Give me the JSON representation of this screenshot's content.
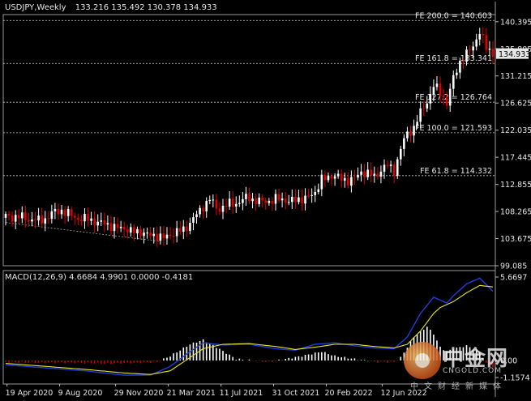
{
  "header": {
    "symbol": "USDJPY,Weekly",
    "ohlc": "133.216 135.492 130.378 134.933"
  },
  "current_price_label": "134.933",
  "macd_header": "MACD(12,26,9) 4.6684 4.9901 0.0000 -0.4181",
  "watermark": {
    "cn": "中金网",
    "en": "CNGOLD.COM",
    "sub": "中文财经新媒体"
  },
  "colors": {
    "background": "#000000",
    "bull": "#ffffff",
    "bear": "#e00000",
    "grid_dash": "#c8c8c8",
    "macd_line": "#1f3fd8",
    "signal_line": "#e8e82a"
  },
  "chart_data": [
    {
      "type": "candlestick",
      "price_axis": {
        "min": 99.085,
        "max": 141.6,
        "ticks": [
          "140.395",
          "135.805",
          "131.215",
          "126.625",
          "122.035",
          "117.445",
          "112.855",
          "108.265",
          "103.675",
          "99.085"
        ]
      },
      "time_axis_labels": [
        "19 Apr 2020",
        "9 Aug 2020",
        "29 Nov 2020",
        "21 Mar 2021",
        "11 Jul 2021",
        "31 Oct 2021",
        "20 Feb 2022",
        "12 Jun 2022"
      ],
      "fibonacci_levels": [
        {
          "label": "FE 200.0 = 140.603",
          "value": 140.603
        },
        {
          "label": "FE 161.8 = 133.341",
          "value": 133.341
        },
        {
          "label": "FE 127.2 = 126.764",
          "value": 126.764
        },
        {
          "label": "FE 100.0 = 121.593",
          "value": 121.593
        },
        {
          "label": "FE 61.8 = 114.332",
          "value": 114.332
        }
      ],
      "close_path": [
        [
          0,
          107.5
        ],
        [
          6,
          107.2
        ],
        [
          10,
          106.6
        ],
        [
          14,
          107.8
        ],
        [
          17,
          108.6
        ],
        [
          20,
          107.4
        ],
        [
          24,
          107.0
        ],
        [
          28,
          106.5
        ],
        [
          32,
          105.8
        ],
        [
          36,
          105.3
        ],
        [
          40,
          104.8
        ],
        [
          44,
          104.3
        ],
        [
          48,
          103.8
        ],
        [
          50,
          104.4
        ],
        [
          54,
          105.2
        ],
        [
          58,
          107.6
        ],
        [
          60,
          109.3
        ],
        [
          62,
          110.3
        ],
        [
          64,
          108.8
        ],
        [
          68,
          109.4
        ],
        [
          72,
          110.2
        ],
        [
          74,
          110.6
        ],
        [
          78,
          109.8
        ],
        [
          82,
          110.4
        ],
        [
          86,
          110.1
        ],
        [
          90,
          110.3
        ],
        [
          94,
          111.4
        ],
        [
          96,
          113.8
        ],
        [
          100,
          114.3
        ],
        [
          104,
          113.4
        ],
        [
          106,
          113.8
        ],
        [
          108,
          115.1
        ],
        [
          110,
          114.6
        ],
        [
          112,
          114.2
        ],
        [
          114,
          115.4
        ],
        [
          116,
          115.9
        ],
        [
          118,
          115.3
        ],
        [
          120,
          118.8
        ],
        [
          122,
          121.5
        ],
        [
          124,
          122.6
        ],
        [
          126,
          124.8
        ],
        [
          128,
          127.0
        ],
        [
          130,
          129.5
        ],
        [
          132,
          128.4
        ],
        [
          134,
          126.7
        ],
        [
          136,
          130.8
        ],
        [
          138,
          133.6
        ],
        [
          140,
          135.0
        ],
        [
          142,
          136.2
        ],
        [
          144,
          138.7
        ],
        [
          146,
          136.1
        ],
        [
          148,
          134.933
        ]
      ],
      "trendline": {
        "from": [
          0,
          106.4
        ],
        "to": [
          47,
          103.2
        ]
      }
    },
    {
      "type": "macd",
      "params": "12,26,9",
      "values": {
        "macd": 4.6684,
        "signal": 4.9901,
        "osma_zero": 0.0,
        "hist": -0.4181
      },
      "axis_labels": [
        "5.6697",
        "0.00",
        "-1.1574"
      ],
      "range": [
        -1.1574,
        5.6697
      ],
      "macd_path": [
        [
          0,
          -0.3
        ],
        [
          12,
          -0.5
        ],
        [
          24,
          -0.7
        ],
        [
          36,
          -1.0
        ],
        [
          44,
          -1.0
        ],
        [
          50,
          -0.4
        ],
        [
          56,
          0.6
        ],
        [
          60,
          1.2
        ],
        [
          66,
          1.05
        ],
        [
          74,
          1.1
        ],
        [
          82,
          0.8
        ],
        [
          88,
          0.7
        ],
        [
          94,
          1.1
        ],
        [
          100,
          1.2
        ],
        [
          106,
          1.0
        ],
        [
          112,
          0.85
        ],
        [
          118,
          0.8
        ],
        [
          122,
          1.6
        ],
        [
          126,
          3.2
        ],
        [
          130,
          4.3
        ],
        [
          132,
          4.1
        ],
        [
          134,
          3.9
        ],
        [
          136,
          4.4
        ],
        [
          140,
          5.2
        ],
        [
          144,
          5.6
        ],
        [
          148,
          4.7
        ]
      ],
      "signal_path": [
        [
          0,
          -0.2
        ],
        [
          12,
          -0.4
        ],
        [
          24,
          -0.6
        ],
        [
          36,
          -0.85
        ],
        [
          44,
          -0.95
        ],
        [
          50,
          -0.7
        ],
        [
          56,
          0.2
        ],
        [
          60,
          0.8
        ],
        [
          66,
          1.1
        ],
        [
          74,
          1.15
        ],
        [
          82,
          0.95
        ],
        [
          88,
          0.75
        ],
        [
          94,
          0.9
        ],
        [
          100,
          1.1
        ],
        [
          106,
          1.1
        ],
        [
          112,
          0.95
        ],
        [
          118,
          0.85
        ],
        [
          122,
          1.1
        ],
        [
          126,
          2.0
        ],
        [
          130,
          3.2
        ],
        [
          132,
          3.6
        ],
        [
          134,
          3.8
        ],
        [
          136,
          4.0
        ],
        [
          140,
          4.6
        ],
        [
          144,
          5.1
        ],
        [
          148,
          5.0
        ]
      ],
      "hist_path": [
        [
          0,
          -0.1
        ],
        [
          10,
          -0.15
        ],
        [
          20,
          -0.15
        ],
        [
          30,
          -0.2
        ],
        [
          40,
          -0.15
        ],
        [
          46,
          -0.1
        ],
        [
          50,
          0.3
        ],
        [
          56,
          1.1
        ],
        [
          60,
          1.4
        ],
        [
          64,
          0.9
        ],
        [
          70,
          0.1
        ],
        [
          80,
          -0.1
        ],
        [
          90,
          0.3
        ],
        [
          96,
          0.6
        ],
        [
          100,
          0.3
        ],
        [
          106,
          0.1
        ],
        [
          112,
          -0.1
        ],
        [
          118,
          -0.1
        ],
        [
          120,
          0.2
        ],
        [
          124,
          1.6
        ],
        [
          128,
          2.3
        ],
        [
          130,
          1.8
        ],
        [
          132,
          0.9
        ],
        [
          134,
          0.6
        ],
        [
          136,
          0.8
        ],
        [
          140,
          1.0
        ],
        [
          144,
          0.6
        ],
        [
          146,
          -0.2
        ],
        [
          148,
          -0.45
        ]
      ]
    }
  ]
}
